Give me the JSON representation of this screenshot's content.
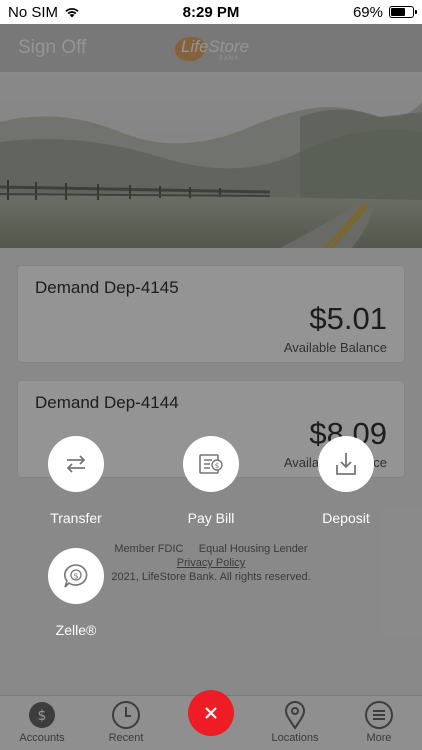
{
  "status_bar": {
    "carrier": "No SIM",
    "time": "8:29 PM",
    "battery": "69%",
    "battery_level": 0.69
  },
  "header": {
    "sign_off": "Sign Off",
    "logo_text": "LifeStore",
    "logo_sub": "BANK"
  },
  "accounts": [
    {
      "name": "Demand Dep-4145",
      "amount": "$5.01",
      "label": "Available Balance"
    },
    {
      "name": "Demand Dep-4144",
      "amount": "$8.09",
      "label": "Available Balance"
    }
  ],
  "footer": {
    "line1": "Member FDIC     Equal Housing Lender",
    "privacy": "Privacy Policy",
    "copyright": "2021, LifeStore Bank. All rights reserved."
  },
  "actions": {
    "transfer": "Transfer",
    "pay_bill": "Pay Bill",
    "deposit": "Deposit",
    "zelle": "Zelle®"
  },
  "tabs": {
    "accounts": "Accounts",
    "recent": "Recent",
    "locations": "Locations",
    "more": "More"
  },
  "colors": {
    "fab": "#ee1c25",
    "logo_accent": "#e8a560"
  }
}
